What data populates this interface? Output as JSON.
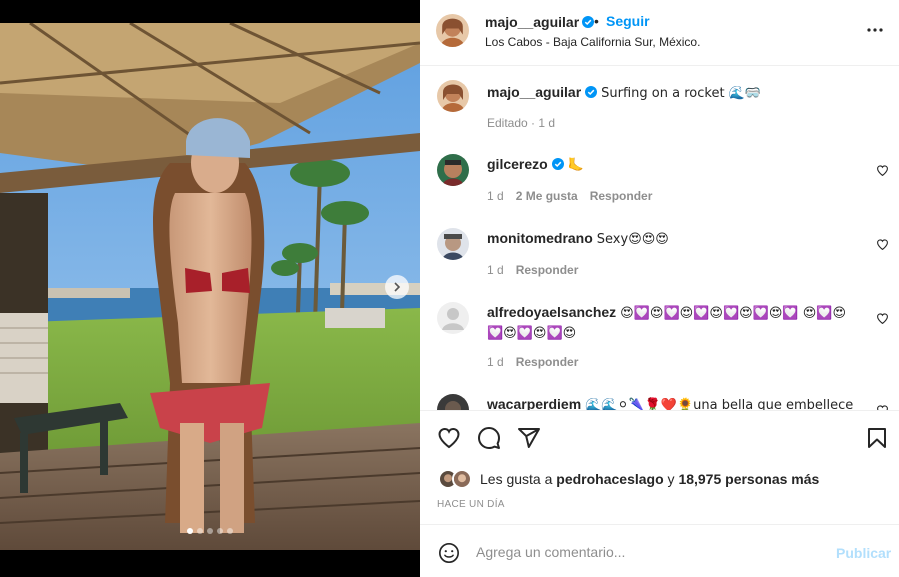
{
  "post": {
    "username": "majo__aguilar",
    "follow_label": "Seguir",
    "bullet": "•",
    "location": "Los Cabos - Baja California Sur, México.",
    "caption": "Surfing on a rocket 🌊🥽",
    "caption_meta": "Editado · 1 d",
    "image_dots": 5,
    "image_active_dot": 0
  },
  "comments": [
    {
      "username": "gilcerezo",
      "verified": true,
      "text": "🦶",
      "time": "1 d",
      "likes": "2 Me gusta",
      "reply": "Responder"
    },
    {
      "username": "monitomedrano",
      "verified": false,
      "text": "Sexy😍😍😍",
      "time": "1 d",
      "reply": "Responder"
    },
    {
      "username": "alfredoyaelsanchez",
      "verified": false,
      "text": "😍💟😍💟😍💟😍💟😍💟😍💟 😍💟😍💟😍💟😍💟😍",
      "time": "1 d",
      "reply": "Responder"
    },
    {
      "username": "wacarperdiem",
      "verified": false,
      "text": "🌊🌊⚪🌂🌹❤️🌻una bella que embellece el",
      "time": "",
      "reply": ""
    }
  ],
  "likes": {
    "prefix": "Les gusta a ",
    "user": "pedrohaceslago",
    "middle": " y ",
    "count": "18,975 personas más"
  },
  "timestamp": "HACE UN DÍA",
  "comment_box": {
    "placeholder": "Agrega un comentario...",
    "publish_label": "Publicar"
  },
  "icons": [
    "verified-icon",
    "more-options-icon",
    "heart-icon",
    "comment-icon",
    "share-icon",
    "bookmark-icon",
    "emoji-icon",
    "chevron-right-icon"
  ],
  "colors": {
    "accent": "#0095f6",
    "publish_disabled": "#b2dffc",
    "text": "#262626",
    "secondary": "#8e8e8e"
  }
}
